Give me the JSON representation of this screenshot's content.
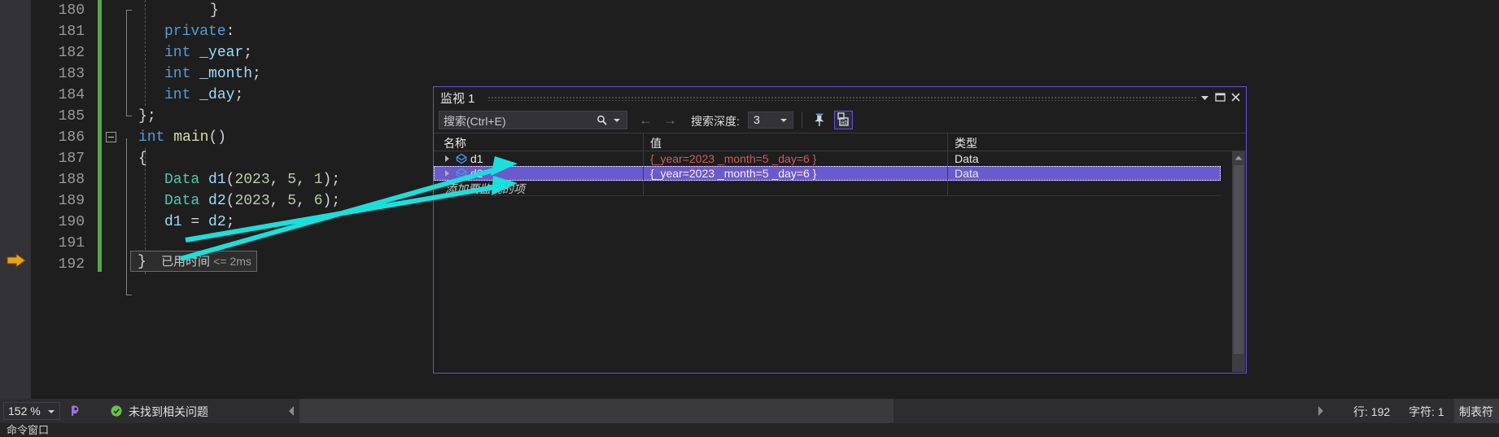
{
  "editor": {
    "lines": [
      {
        "num": "180",
        "indent": 110,
        "tokens": [
          {
            "t": "}",
            "c": "br"
          }
        ]
      },
      {
        "num": "181",
        "indent": 54,
        "tokens": [
          {
            "t": "private",
            "c": "k"
          },
          {
            "t": ":",
            "c": "pl"
          }
        ]
      },
      {
        "num": "182",
        "indent": 54,
        "tokens": [
          {
            "t": "int",
            "c": "k"
          },
          {
            "t": " ",
            "c": "pl"
          },
          {
            "t": "_year",
            "c": "id"
          },
          {
            "t": ";",
            "c": "pl"
          }
        ]
      },
      {
        "num": "183",
        "indent": 54,
        "tokens": [
          {
            "t": "int",
            "c": "k"
          },
          {
            "t": " ",
            "c": "pl"
          },
          {
            "t": "_month",
            "c": "id"
          },
          {
            "t": ";",
            "c": "pl"
          }
        ]
      },
      {
        "num": "184",
        "indent": 54,
        "tokens": [
          {
            "t": "int",
            "c": "k"
          },
          {
            "t": " ",
            "c": "pl"
          },
          {
            "t": "_day",
            "c": "id"
          },
          {
            "t": ";",
            "c": "pl"
          }
        ]
      },
      {
        "num": "185",
        "indent": 22,
        "tokens": [
          {
            "t": "}",
            "c": "br"
          },
          {
            "t": ";",
            "c": "pl"
          }
        ]
      },
      {
        "num": "186",
        "indent": 22,
        "tokens": [
          {
            "t": "int",
            "c": "k"
          },
          {
            "t": " ",
            "c": "pl"
          },
          {
            "t": "main",
            "c": "fn"
          },
          {
            "t": "()",
            "c": "br"
          }
        ]
      },
      {
        "num": "187",
        "indent": 22,
        "tokens": [
          {
            "t": "{",
            "c": "br"
          }
        ]
      },
      {
        "num": "188",
        "indent": 54,
        "tokens": [
          {
            "t": "Data",
            "c": "ty"
          },
          {
            "t": " ",
            "c": "pl"
          },
          {
            "t": "d1",
            "c": "id"
          },
          {
            "t": "(",
            "c": "br"
          },
          {
            "t": "2023",
            "c": "num"
          },
          {
            "t": ", ",
            "c": "pl"
          },
          {
            "t": "5",
            "c": "num"
          },
          {
            "t": ", ",
            "c": "pl"
          },
          {
            "t": "1",
            "c": "num"
          },
          {
            "t": ")",
            "c": "br"
          },
          {
            "t": ";",
            "c": "pl"
          }
        ]
      },
      {
        "num": "189",
        "indent": 54,
        "tokens": [
          {
            "t": "Data",
            "c": "ty"
          },
          {
            "t": " ",
            "c": "pl"
          },
          {
            "t": "d2",
            "c": "id"
          },
          {
            "t": "(",
            "c": "br"
          },
          {
            "t": "2023",
            "c": "num"
          },
          {
            "t": ", ",
            "c": "pl"
          },
          {
            "t": "5",
            "c": "num"
          },
          {
            "t": ", ",
            "c": "pl"
          },
          {
            "t": "6",
            "c": "num"
          },
          {
            "t": ")",
            "c": "br"
          },
          {
            "t": ";",
            "c": "pl"
          }
        ]
      },
      {
        "num": "190",
        "indent": 54,
        "tokens": [
          {
            "t": "d1",
            "c": "id"
          },
          {
            "t": " = ",
            "c": "pl"
          },
          {
            "t": "d2",
            "c": "id"
          },
          {
            "t": ";",
            "c": "pl"
          }
        ]
      },
      {
        "num": "191",
        "indent": 54,
        "tokens": []
      },
      {
        "num": "192",
        "indent": 22,
        "tokens": []
      }
    ],
    "elapsed": {
      "brace": "}",
      "label": "已用时间",
      "value": "<= 2ms"
    }
  },
  "watch": {
    "title": "监视 1",
    "title_buttons": {
      "dropdown": "chevron-down-icon",
      "float": "float-window-icon",
      "close": "close-icon"
    },
    "toolbar": {
      "search_placeholder": "搜索(Ctrl+E)",
      "search_value": "",
      "prev_label": "←",
      "next_label": "→",
      "depth_label": "搜索深度:",
      "depth_value": "3",
      "pin_icon": "pin-icon",
      "hex_icon": "show-raw-values-icon"
    },
    "columns": [
      "名称",
      "值",
      "类型"
    ],
    "rows": [
      {
        "name": "d1",
        "value": "{_year=2023 _month=5 _day=6 }",
        "type": "Data",
        "selected": false,
        "expandable": true
      },
      {
        "name": "d2",
        "value": "{_year=2023 _month=5 _day=6 }",
        "type": "Data",
        "selected": true,
        "expandable": true
      }
    ],
    "add_row_placeholder": "添加要监视的项"
  },
  "statusbar": {
    "zoom": "152 %",
    "message": "未找到相关问题",
    "line_label": "行: 192",
    "col_label": "字符: 1",
    "mode_label": "制表符"
  },
  "bottom": {
    "text": "命令窗口"
  },
  "colors": {
    "accent_border": "#6b4fd8",
    "selection": "#6a5acd",
    "value_text": "#cd5c5c",
    "arrow": "#19e0dd",
    "changed_line": "#57a64a",
    "stmt_arrow": "#e8a317"
  }
}
